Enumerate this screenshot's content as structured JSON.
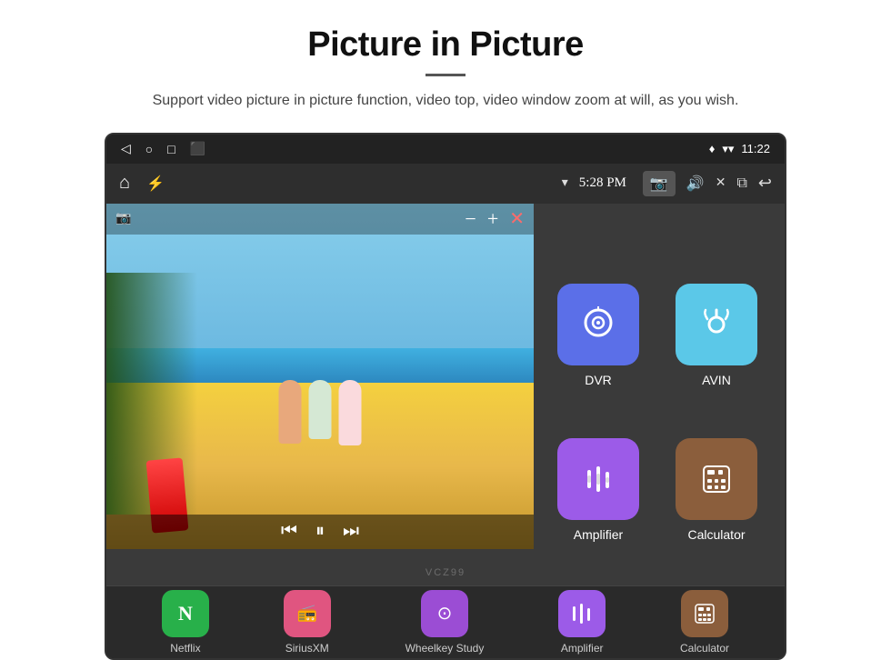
{
  "page": {
    "title": "Picture in Picture",
    "subtitle": "Support video picture in picture function, video top, video window zoom at will, as you wish.",
    "divider": true
  },
  "device": {
    "statusBar": {
      "back": "◁",
      "home": "○",
      "recent": "□",
      "screenshot": "⬛",
      "time": "11:22",
      "location": "♦",
      "wifi": "▾"
    },
    "controlBar": {
      "home": "⌂",
      "usb": "⚡",
      "wifi": "▾",
      "time": "5:28 PM",
      "camera": "📷",
      "volume": "🔊",
      "close": "✕",
      "pip": "⧉",
      "back": "↩"
    },
    "pipVideo": {
      "cameraIcon": "📷",
      "minusBtn": "−",
      "plusBtn": "+",
      "closeBtn": "✕",
      "prevBtn": "⏮",
      "playBtn": "⏸",
      "nextBtn": "⏭"
    },
    "apps": [
      {
        "id": "dvr",
        "label": "DVR",
        "colorClass": "icon-dvr",
        "icon": "📡"
      },
      {
        "id": "avin",
        "label": "AVIN",
        "colorClass": "icon-avin",
        "icon": "🔌"
      },
      {
        "id": "amplifier",
        "label": "Amplifier",
        "colorClass": "icon-amplifier",
        "icon": "🎚"
      },
      {
        "id": "calculator",
        "label": "Calculator",
        "colorClass": "icon-calculator",
        "icon": "🧮"
      }
    ],
    "bottomApps": [
      {
        "id": "netflix",
        "label": "Netflix",
        "colorClass": "icon-netflix",
        "icon": "▶"
      },
      {
        "id": "siriusxm",
        "label": "SiriusXM",
        "colorClass": "icon-siriusxm",
        "icon": "📻"
      },
      {
        "id": "wheelkey",
        "label": "Wheelkey Study",
        "colorClass": "icon-wheelkey",
        "icon": "⊙"
      },
      {
        "id": "amplifier-sm",
        "label": "Amplifier",
        "colorClass": "icon-amplifier-sm",
        "icon": "🎚"
      },
      {
        "id": "calculator-sm",
        "label": "Calculator",
        "colorClass": "icon-calculator-sm",
        "icon": "🧮"
      }
    ],
    "watermark": "VCZ99"
  }
}
